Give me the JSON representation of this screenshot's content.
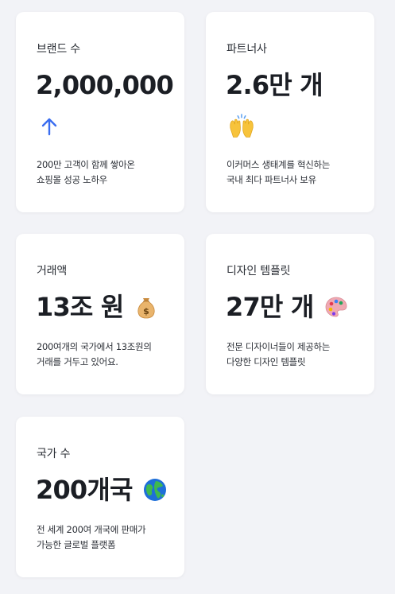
{
  "stats": {
    "brands": {
      "label": "브랜드 수",
      "value": "2,000,000",
      "icon": "arrow-up-icon",
      "desc": [
        "200만 고객이 함께 쌓아온",
        "쇼핑몰 성공 노하우"
      ]
    },
    "partners": {
      "label": "파트너사",
      "value": "2.6만 개",
      "icon": "raising-hands-icon",
      "desc": [
        "이커머스 생태계를 혁신하는",
        "국내 최다 파트너사 보유"
      ]
    },
    "volume": {
      "label": "거래액",
      "value": "13조 원",
      "icon": "money-bag-icon",
      "desc": [
        "200여개의 국가에서 13조원의",
        "거래를 거두고 있어요."
      ]
    },
    "templates": {
      "label": "디자인 템플릿",
      "value": "27만 개",
      "icon": "artist-palette-icon",
      "desc": [
        "전문 디자이너들이 제공하는",
        "다양한 디자인 템플릿"
      ]
    },
    "countries": {
      "label": "국가 수",
      "value": "200개국",
      "icon": "globe-icon",
      "desc": [
        "전 세계 200여 개국에 판매가",
        "가능한 글로벌 플랫폼"
      ]
    }
  },
  "colors": {
    "background": "#f2f3f7",
    "card": "#ffffff",
    "accent_arrow": "#3a6df0",
    "text_primary": "#1b1e24"
  }
}
